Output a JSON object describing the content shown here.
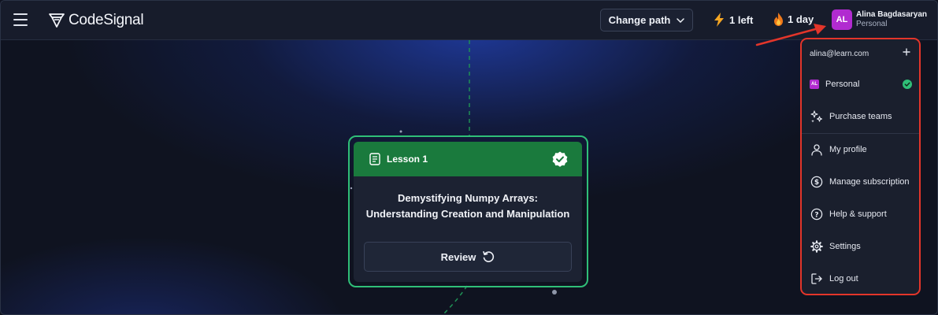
{
  "header": {
    "brand": "CodeSignal",
    "change_path_label": "Change path",
    "energy_label": "1 left",
    "streak_label": "1 day",
    "avatar_initials": "AL",
    "user_name": "Alina Bagdasaryan",
    "user_plan": "Personal"
  },
  "lesson": {
    "label": "Lesson 1",
    "title_line1": "Demystifying Numpy Arrays:",
    "title_line2": "Understanding Creation and Manipulation",
    "review_label": "Review"
  },
  "menu": {
    "email": "alina@learn.com",
    "account_initials": "AL",
    "items": [
      {
        "label": "Personal",
        "icon": "avatar-icon"
      },
      {
        "label": "Purchase teams",
        "icon": "sparkles-icon"
      },
      {
        "label": "My profile",
        "icon": "user-icon"
      },
      {
        "label": "Manage subscription",
        "icon": "dollar-icon"
      },
      {
        "label": "Help & support",
        "icon": "question-icon"
      },
      {
        "label": "Settings",
        "icon": "gear-icon"
      },
      {
        "label": "Log out",
        "icon": "logout-icon"
      }
    ]
  },
  "colors": {
    "accent_green": "#1a7a3d",
    "outline_green": "#2fbf78",
    "avatar_purple": "#b12bd0",
    "annotation_red": "#e3352a"
  }
}
